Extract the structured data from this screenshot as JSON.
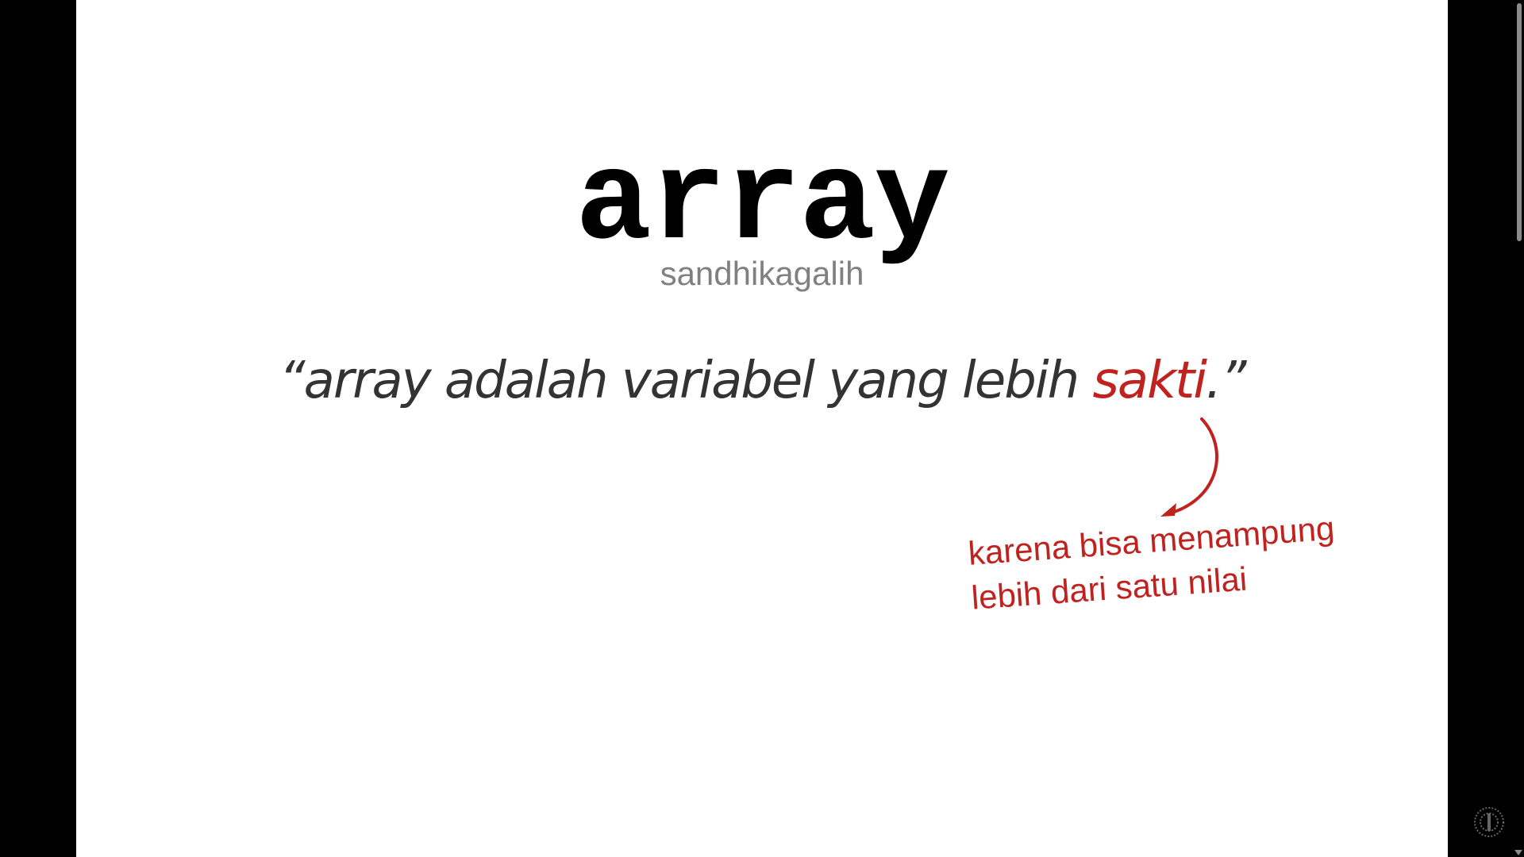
{
  "slide": {
    "title": "array",
    "author": "sandhikagalih",
    "quote": {
      "open": "“array adalah variabel yang lebih ",
      "highlight": "sakti",
      "close": ".”"
    },
    "annotation": {
      "line1": "karena bisa menampung",
      "line2": "lebih dari satu nilai"
    }
  },
  "colors": {
    "background": "#ffffff",
    "letterbox": "#000000",
    "title": "#000000",
    "author": "#808080",
    "quote": "#333333",
    "accent": "#c0231f"
  },
  "icons": {
    "arrow": "curved-arrow-icon",
    "corner": "channel-logo-icon"
  }
}
